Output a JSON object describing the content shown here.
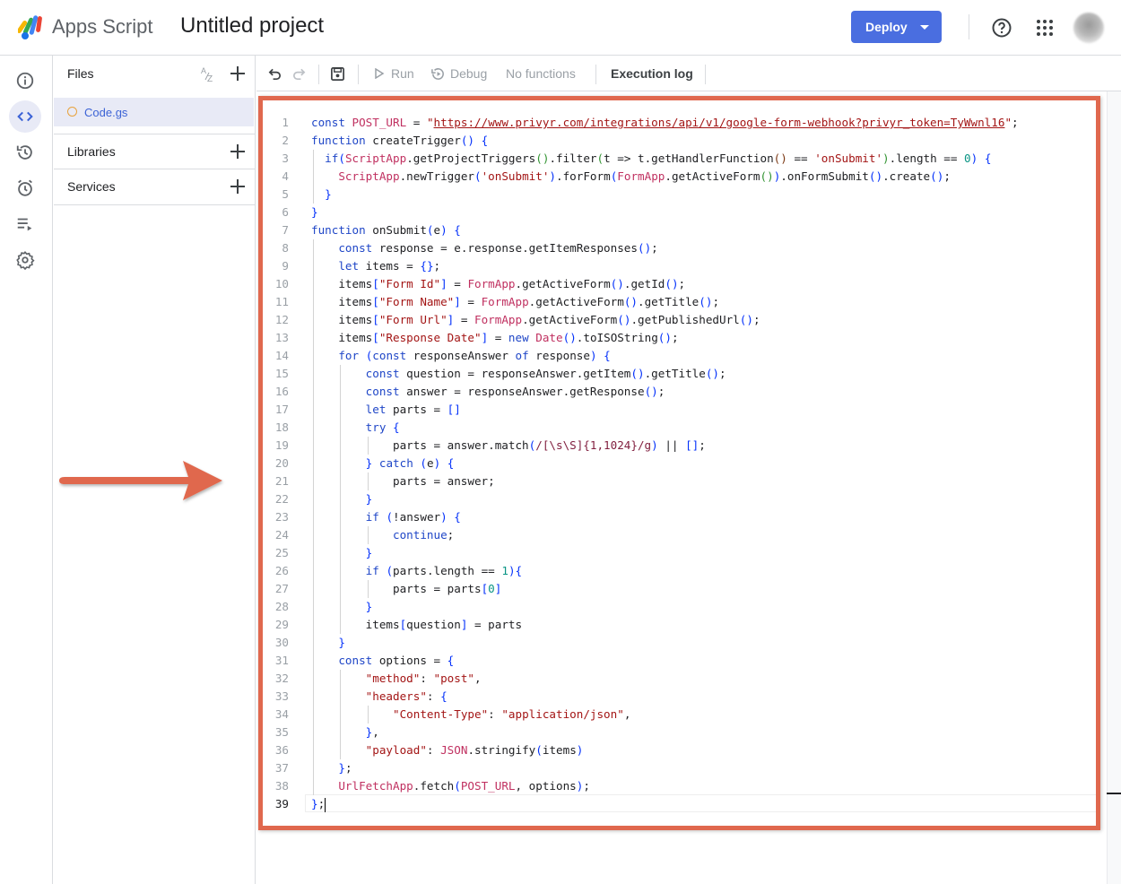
{
  "header": {
    "app_name": "Apps Script",
    "project_title": "Untitled project",
    "deploy_label": "Deploy"
  },
  "rail": {
    "items": [
      "overview-icon",
      "editor-icon",
      "executions-history-icon",
      "triggers-icon",
      "executions-icon",
      "settings-icon"
    ]
  },
  "files_panel": {
    "files_label": "Files",
    "files": [
      {
        "name": "Code.gs"
      }
    ],
    "libraries_label": "Libraries",
    "services_label": "Services"
  },
  "toolbar": {
    "run_label": "Run",
    "debug_label": "Debug",
    "function_select": "No functions",
    "execution_log_label": "Execution log"
  },
  "editor": {
    "file": "Code.gs",
    "current_line": 39,
    "lines": [
      "const POST_URL = \"https://www.privyr.com/integrations/api/v1/google-form-webhook?privyr_token=TyWwnl16\";",
      "function createTrigger() {",
      "  if(ScriptApp.getProjectTriggers().filter(t => t.getHandlerFunction() == 'onSubmit').length == 0) {",
      "    ScriptApp.newTrigger('onSubmit').forForm(FormApp.getActiveForm()).onFormSubmit().create();",
      "  }",
      "}",
      "function onSubmit(e) {",
      "    const response = e.response.getItemResponses();",
      "    let items = {};",
      "    items[\"Form Id\"] = FormApp.getActiveForm().getId();",
      "    items[\"Form Name\"] = FormApp.getActiveForm().getTitle();",
      "    items[\"Form Url\"] = FormApp.getActiveForm().getPublishedUrl();",
      "    items[\"Response Date\"] = new Date().toISOString();",
      "    for (const responseAnswer of response) {",
      "        const question = responseAnswer.getItem().getTitle();",
      "        const answer = responseAnswer.getResponse();",
      "        let parts = []",
      "        try {",
      "            parts = answer.match(/[\\s\\S]{1,1024}/g) || [];",
      "        } catch (e) {",
      "            parts = answer;",
      "        }",
      "        if (!answer) {",
      "            continue;",
      "        }",
      "        if (parts.length == 1){",
      "            parts = parts[0]",
      "        }",
      "        items[question] = parts",
      "    }",
      "    const options = {",
      "        \"method\": \"post\",",
      "        \"headers\": {",
      "            \"Content-Type\": \"application/json\",",
      "        },",
      "        \"payload\": JSON.stringify(items)",
      "    };",
      "    UrlFetchApp.fetch(POST_URL, options);",
      "};"
    ]
  },
  "annotations": {
    "arrow_color": "#e0684e",
    "highlight_color": "#e0684e"
  }
}
